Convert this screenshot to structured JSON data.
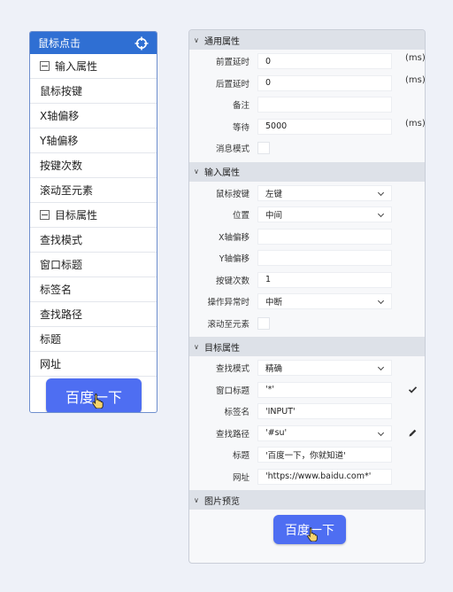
{
  "left_panel": {
    "title": "鼠标点击",
    "items": [
      {
        "label": "输入属性",
        "section": true
      },
      {
        "label": "鼠标按键"
      },
      {
        "label": "X轴偏移"
      },
      {
        "label": "Y轴偏移"
      },
      {
        "label": "按键次数"
      },
      {
        "label": "滚动至元素"
      },
      {
        "label": "目标属性",
        "section": true
      },
      {
        "label": "查找模式"
      },
      {
        "label": "窗口标题"
      },
      {
        "label": "标签名"
      },
      {
        "label": "查找路径"
      },
      {
        "label": "标题"
      },
      {
        "label": "网址"
      }
    ],
    "preview_button": "百度一下"
  },
  "right_panel": {
    "sections": [
      {
        "title": "通用属性",
        "fields": [
          {
            "label": "前置延时",
            "value": "0",
            "type": "input",
            "unit": "(ms)"
          },
          {
            "label": "后置延时",
            "value": "0",
            "type": "input",
            "unit": "(ms)"
          },
          {
            "label": "备注",
            "value": "",
            "type": "input"
          },
          {
            "label": "等待",
            "value": "5000",
            "type": "input",
            "unit": "(ms)"
          },
          {
            "label": "消息模式",
            "type": "checkbox",
            "checked": false
          }
        ]
      },
      {
        "title": "输入属性",
        "fields": [
          {
            "label": "鼠标按键",
            "value": "左键",
            "type": "select"
          },
          {
            "label": "位置",
            "value": "中间",
            "type": "select"
          },
          {
            "label": "X轴偏移",
            "value": "",
            "type": "input"
          },
          {
            "label": "Y轴偏移",
            "value": "",
            "type": "input"
          },
          {
            "label": "按键次数",
            "value": "1",
            "type": "input"
          },
          {
            "label": "操作异常时",
            "value": "中断",
            "type": "select"
          },
          {
            "label": "滚动至元素",
            "type": "checkbox",
            "checked": false
          }
        ]
      },
      {
        "title": "目标属性",
        "fields": [
          {
            "label": "查找模式",
            "value": "精确",
            "type": "select"
          },
          {
            "label": "窗口标题",
            "value": "'*'",
            "type": "input",
            "icon": "checkmark-icon"
          },
          {
            "label": "标签名",
            "value": "'INPUT'",
            "type": "input"
          },
          {
            "label": "查找路径",
            "value": "'#su'",
            "type": "select",
            "icon": "pencil-icon"
          },
          {
            "label": "标题",
            "value": "'百度一下，你就知道'",
            "type": "input"
          },
          {
            "label": "网址",
            "value": "'https://www.baidu.com*'",
            "type": "input"
          }
        ]
      },
      {
        "title": "图片预览",
        "fields": []
      }
    ],
    "preview_button": "百度一下"
  },
  "colors": {
    "background": "#eef1f8",
    "header_blue": "#2f6fd3",
    "baidu_button": "#4e6ef2",
    "section_header": "#dde1e8"
  }
}
